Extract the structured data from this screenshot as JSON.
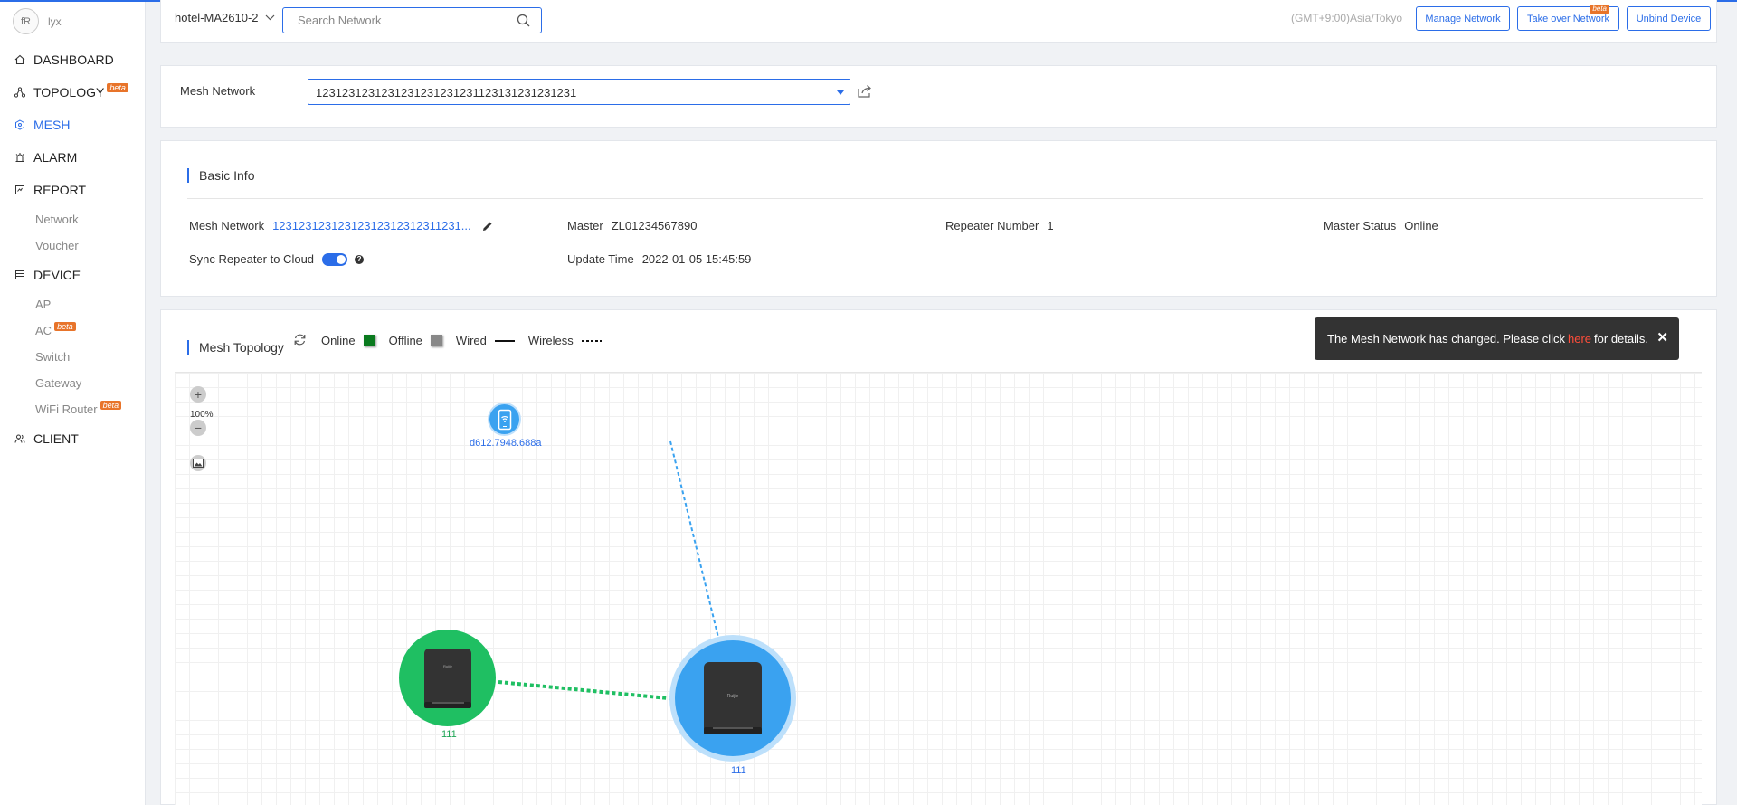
{
  "user": {
    "avatar_text": "fR",
    "name": "lyx"
  },
  "sidebar": {
    "items": [
      {
        "label": "DASHBOARD",
        "icon": "home-icon"
      },
      {
        "label": "TOPOLOGY",
        "icon": "topology-icon",
        "badge": "beta"
      },
      {
        "label": "MESH",
        "icon": "mesh-icon",
        "active": true
      },
      {
        "label": "ALARM",
        "icon": "alarm-icon"
      },
      {
        "label": "REPORT",
        "icon": "report-icon"
      },
      {
        "label": "DEVICE",
        "icon": "device-icon"
      },
      {
        "label": "CLIENT",
        "icon": "client-icon"
      }
    ],
    "report_sub": [
      "Network",
      "Voucher"
    ],
    "device_sub": [
      {
        "label": "AP"
      },
      {
        "label": "AC",
        "badge": "beta"
      },
      {
        "label": "Switch"
      },
      {
        "label": "Gateway"
      },
      {
        "label": "WiFi Router",
        "badge": "beta"
      }
    ]
  },
  "header": {
    "project": "hotel-MA2610-2",
    "search_placeholder": "Search Network",
    "timezone": "(GMT+9:00)Asia/Tokyo",
    "buttons": {
      "manage": "Manage Network",
      "takeover": "Take over Network",
      "takeover_badge": "beta",
      "unbind": "Unbind Device"
    }
  },
  "mesh_selector": {
    "label": "Mesh Network",
    "value": "1231231231231231231231231123131231231231"
  },
  "basic_info": {
    "title": "Basic Info",
    "mesh_network_label": "Mesh Network",
    "mesh_network_value": "12312312312312312312312311231...",
    "master_label": "Master",
    "master_value": "ZL01234567890",
    "repeater_label": "Repeater Number",
    "repeater_value": "1",
    "master_status_label": "Master Status",
    "master_status_value": "Online",
    "sync_label": "Sync Repeater to Cloud",
    "sync_enabled": true,
    "update_label": "Update Time",
    "update_value": "2022-01-05 15:45:59"
  },
  "topology": {
    "title": "Mesh Topology",
    "legend": {
      "online": "Online",
      "offline": "Offline",
      "wired": "Wired",
      "wireless": "Wireless",
      "online_color": "#0a7a1e",
      "offline_color": "#888888"
    },
    "toast": {
      "before": "The Mesh Network has changed. Please click",
      "link": "here",
      "after": "for details.",
      "close": "✕"
    },
    "zoom": {
      "in": "+",
      "level": "100%",
      "out": "−"
    },
    "nodes": {
      "client_label": "d612.7948.688a",
      "repeater_label": "111",
      "master_label": "111"
    },
    "colors": {
      "master": "#3aa2f0",
      "repeater": "#1fbf62",
      "client": "#3aa2f0"
    }
  }
}
